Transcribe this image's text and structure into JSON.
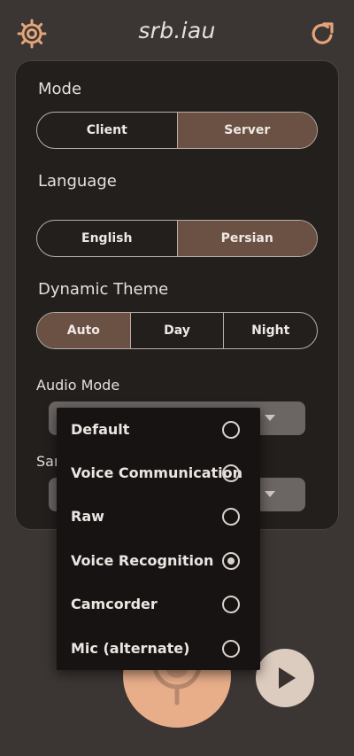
{
  "header": {
    "title": "srb.iau",
    "settings_icon": "gear-icon",
    "refresh_icon": "refresh-icon"
  },
  "settings": {
    "mode": {
      "label": "Mode",
      "options": [
        "Client",
        "Server"
      ],
      "selected": "Server"
    },
    "language": {
      "label": "Language",
      "options": [
        "English",
        "Persian"
      ],
      "selected": "Persian"
    },
    "theme": {
      "label": "Dynamic Theme",
      "options": [
        "Auto",
        "Day",
        "Night"
      ],
      "selected": "Auto"
    },
    "audio_mode": {
      "label": "Audio Mode",
      "options": [
        "Default",
        "Voice Communication",
        "Raw",
        "Voice Recognition",
        "Camcorder",
        "Mic (alternate)"
      ],
      "selected": "Voice Recognition"
    },
    "sample_rate": {
      "label_visible": "Sar"
    }
  },
  "controls": {
    "mic_icon": "microphone-icon",
    "play_icon": "play-icon"
  },
  "colors": {
    "background": "#3b3533",
    "card": "#221f1d",
    "selected_segment": "#6a5143",
    "mic_button": "#e8ae8a",
    "play_button": "#dccbbf",
    "accent": "#e3a47a"
  }
}
